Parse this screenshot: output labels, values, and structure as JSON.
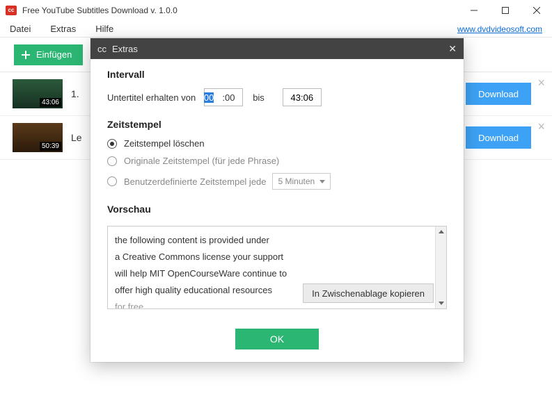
{
  "window": {
    "title": "Free YouTube Subtitles Download v. 1.0.0",
    "icon_text": "cc"
  },
  "menubar": {
    "items": [
      "Datei",
      "Extras",
      "Hilfe"
    ],
    "link": "www.dvdvideosoft.com"
  },
  "toolbar": {
    "add_label": "Einfügen"
  },
  "list": [
    {
      "title_frag": "1.",
      "duration": "43:06",
      "download": "Download"
    },
    {
      "title_frag": "Le",
      "duration": "50:39",
      "download": "Download"
    }
  ],
  "modal": {
    "title": "Extras",
    "icon_text": "cc",
    "interval": {
      "heading": "Intervall",
      "label": "Untertitel erhalten von",
      "start_sel": "00",
      "start_rest": ":00",
      "mid": "bis",
      "end": "43:06"
    },
    "timestamp": {
      "heading": "Zeitstempel",
      "opt_delete": "Zeitstempel löschen",
      "opt_original": "Originale Zeitstempel (für jede Phrase)",
      "opt_custom": "Benutzerdefinierte Zeitstempel jede",
      "custom_value": "5 Minuten"
    },
    "preview": {
      "heading": "Vorschau",
      "lines": [
        "the following content is provided under",
        "a Creative Commons license your support",
        "will help MIT OpenCourseWare continue to",
        "offer high quality educational resources",
        "for free"
      ],
      "copy_label": "In Zwischenablage kopieren"
    },
    "ok_label": "OK"
  }
}
